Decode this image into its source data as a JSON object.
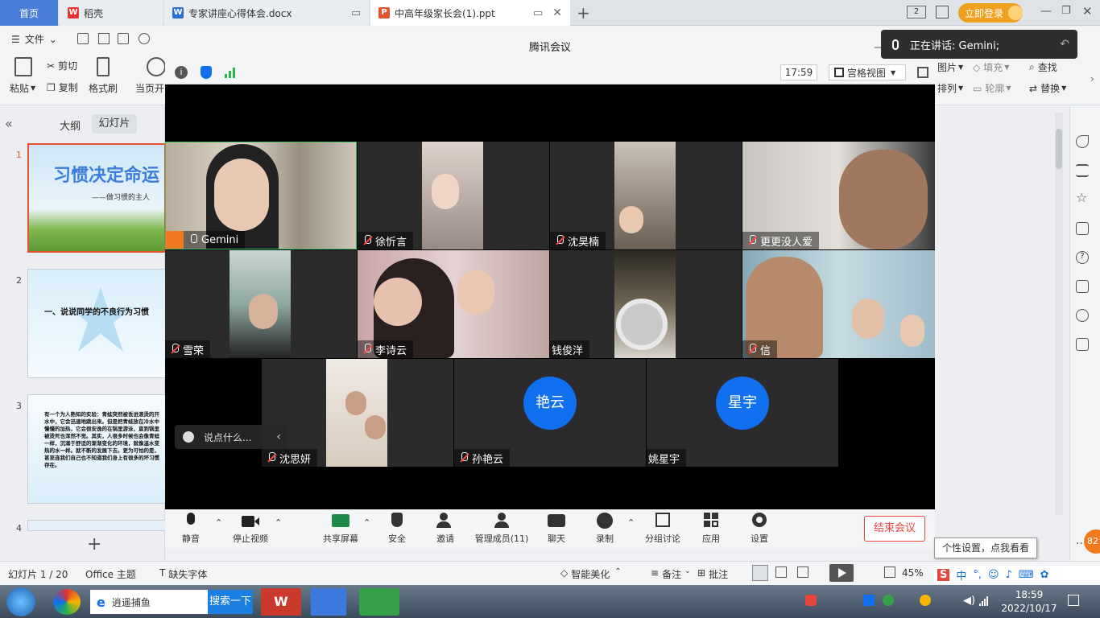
{
  "browser_tabs": [
    {
      "label": "首页"
    },
    {
      "label": "稻壳"
    },
    {
      "label": "专家讲座心得体会.docx"
    },
    {
      "label": "中高年级家长会(1).ppt"
    }
  ],
  "login_label": "立即登录",
  "tab_counter": "2",
  "ribbon": {
    "file_menu": "文件",
    "paste": "粘贴",
    "cut": "剪切",
    "copy": "复制",
    "format_painter": "格式刷",
    "from_current": "当页开",
    "picture": "图片",
    "fill": "填充",
    "find": "查找",
    "arrange": "排列",
    "outline": "轮廓",
    "replace": "替换"
  },
  "left_panel": {
    "tab_outline": "大纲",
    "tab_slides": "幻灯片",
    "slides": [
      {
        "num": "1",
        "title": "习惯决定命运",
        "subtitle": "——做习惯的主人"
      },
      {
        "num": "2",
        "title": "一、说说同学的不良行为习惯"
      },
      {
        "num": "3",
        "title": "有一个为人熟知的实验：青蛙突然被丢进滚烫的开水中，它会迅速地跳出来。但是把青蛙放在冷水中慢慢的加热，它会很安逸的在锅里游泳，直到锅里被烫死也浑然不觉。其实，人很多时候也会像青蛙一样，沉溺于舒适的渐渐变化的环境，就像温水变热的水一样。就不断的发展下去。更为可怕的是，甚至连我们自己也不知道我们身上有很多的坏习惯存在。"
      },
      {
        "num": "4"
      }
    ]
  },
  "meeting": {
    "title": "腾讯会议",
    "clock": "17:59",
    "view_label": "宫格视图",
    "participants": [
      {
        "name": "Gemini"
      },
      {
        "name": "徐忻言"
      },
      {
        "name": "沈昊楠"
      },
      {
        "name": "更更没人爱"
      },
      {
        "name": "雪荣"
      },
      {
        "name": "李诗云"
      },
      {
        "name": "钱俊洋"
      },
      {
        "name": "信"
      },
      {
        "name": "沈思妍"
      },
      {
        "name": "孙艳云",
        "avatar": "艳云"
      },
      {
        "name": "姚星宇",
        "avatar": "星宇"
      }
    ],
    "chat_placeholder": "说点什么...",
    "toolbar": {
      "mute": "静音",
      "stop_video": "停止视频",
      "share": "共享屏幕",
      "security": "安全",
      "invite": "邀请",
      "members": "管理成员(11)",
      "chat": "聊天",
      "record": "录制",
      "breakout": "分组讨论",
      "apps": "应用",
      "settings": "设置",
      "end": "结束会议"
    }
  },
  "speaking": "正在讲话: Gemini;",
  "statusbar": {
    "slide": "幻灯片 1 / 20",
    "theme": "Office 主题",
    "missing_font": "缺失字体",
    "beautify": "智能美化",
    "notes": "备注",
    "comments": "批注",
    "zoom": "45%"
  },
  "tooltip": "个性设置，点我看看",
  "badge_82": "82",
  "taskbar": {
    "app1": "逍遥捕鱼",
    "search": "搜索一下",
    "time": "18:59",
    "date": "2022/10/17",
    "ime": "中"
  }
}
